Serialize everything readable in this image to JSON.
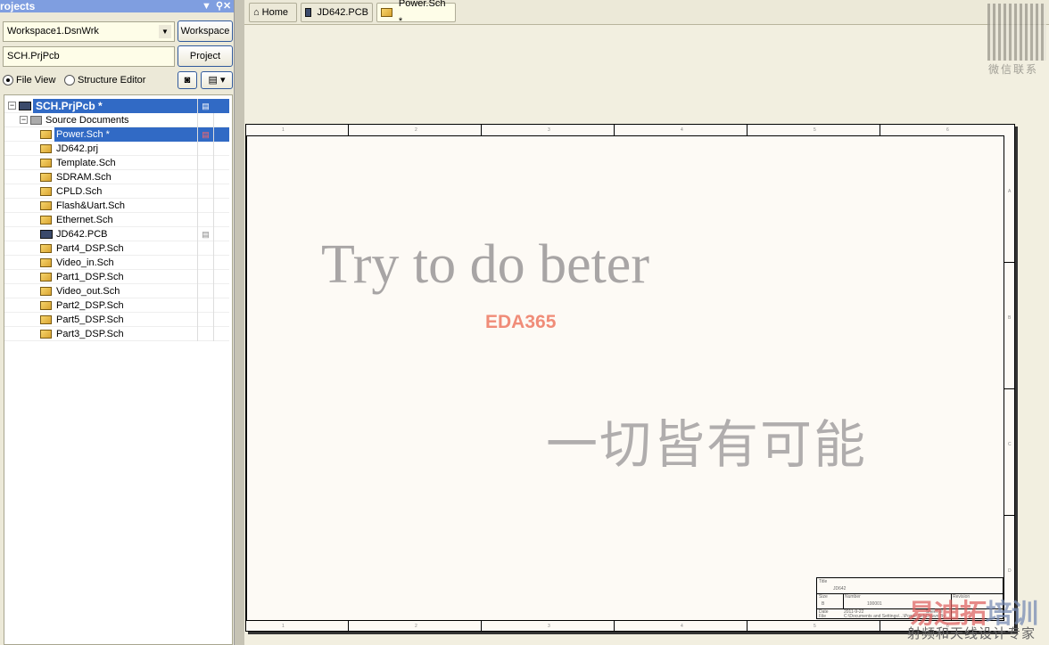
{
  "panel": {
    "title": "rojects",
    "workspace_value": "Workspace1.DsnWrk",
    "workspace_button": "Workspace",
    "project_value": "SCH.PrjPcb",
    "project_button": "Project",
    "file_view": "File View",
    "structure_editor": "Structure Editor",
    "view_mode": "File View"
  },
  "tree": {
    "project": "SCH.PrjPcb *",
    "folder": "Source Documents",
    "items": [
      {
        "name": "Power.Sch *",
        "type": "sch",
        "selected": true
      },
      {
        "name": "JD642.prj",
        "type": "sch"
      },
      {
        "name": "Template.Sch",
        "type": "sch"
      },
      {
        "name": "SDRAM.Sch",
        "type": "sch"
      },
      {
        "name": "CPLD.Sch",
        "type": "sch"
      },
      {
        "name": "Flash&Uart.Sch",
        "type": "sch"
      },
      {
        "name": "Ethernet.Sch",
        "type": "sch"
      },
      {
        "name": "JD642.PCB",
        "type": "pcb"
      },
      {
        "name": "Part4_DSP.Sch",
        "type": "sch"
      },
      {
        "name": "Video_in.Sch",
        "type": "sch"
      },
      {
        "name": "Part1_DSP.Sch",
        "type": "sch"
      },
      {
        "name": "Video_out.Sch",
        "type": "sch"
      },
      {
        "name": "Part2_DSP.Sch",
        "type": "sch"
      },
      {
        "name": "Part5_DSP.Sch",
        "type": "sch"
      },
      {
        "name": "Part3_DSP.Sch",
        "type": "sch"
      }
    ]
  },
  "tabs": [
    {
      "label": "Home",
      "icon": "home-icon"
    },
    {
      "label": "JD642.PCB",
      "icon": "pcb-icon"
    },
    {
      "label": "Power.Sch *",
      "icon": "schematic-icon",
      "active": true
    }
  ],
  "sheet": {
    "watermark_en": "Try to do beter",
    "watermark_brand": "EDA365",
    "watermark_cn": "一切皆有可能",
    "columns": [
      "1",
      "2",
      "3",
      "4",
      "5",
      "6"
    ],
    "rows": [
      "A",
      "B",
      "C",
      "D"
    ],
    "title_block": {
      "title_label": "Title",
      "title": "JD642",
      "size_label": "Size",
      "size": "B",
      "number_label": "Number",
      "number": "100001",
      "revision_label": "Revision",
      "date_label": "Date",
      "date": "2011-9-22",
      "file_label": "File",
      "file": "C:\\Documents and Settings\\...\\Power.Sch",
      "sheet_label": "Sheet  of",
      "drawn_label": "Drawn By:"
    }
  },
  "overlay": {
    "brand_red": "易迪拓",
    "brand_blue": "培训",
    "tagline": "射频和天线设计专家",
    "qr_label": "微信联系"
  }
}
